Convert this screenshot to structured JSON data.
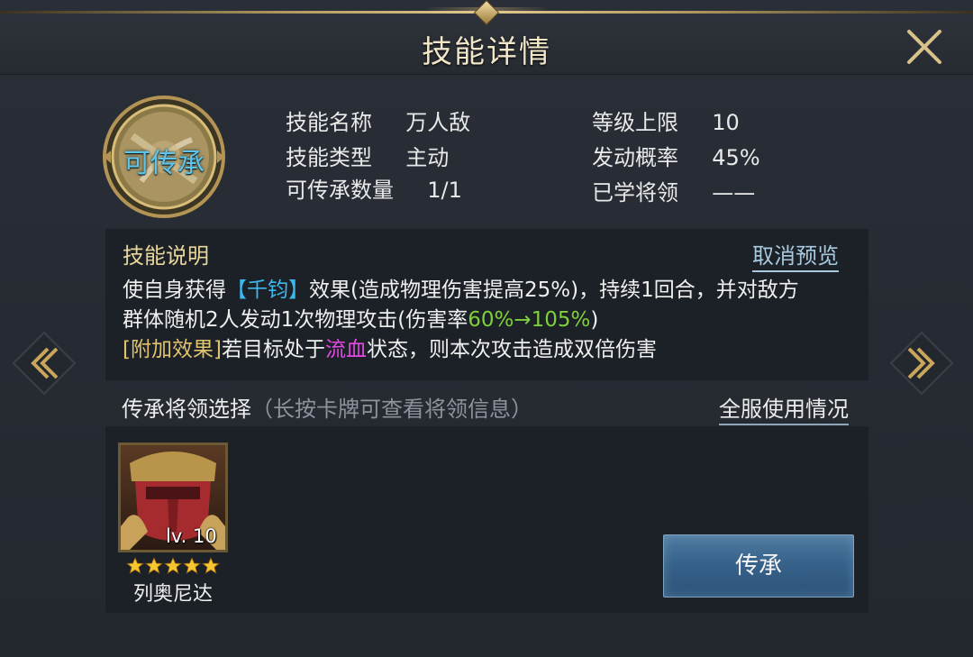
{
  "header": {
    "title": "技能详情"
  },
  "skill_icon": {
    "label": "可传承"
  },
  "info": {
    "name_label": "技能名称",
    "name_value": "万人敌",
    "type_label": "技能类型",
    "type_value": "主动",
    "count_label": "可传承数量",
    "count_value": "1/1",
    "max_level_label": "等级上限",
    "max_level_value": "10",
    "chance_label": "发动概率",
    "chance_value": "45%",
    "learned_label": "已学将领",
    "learned_value": "——"
  },
  "description": {
    "title": "技能说明",
    "cancel_preview": "取消预览",
    "line1_a": "使自身获得",
    "line1_effect": "【千钧】",
    "line1_b": "效果(造成物理伤害提高25%)，持续1回合，并对敌方",
    "line2_a": "群体随机2人发动1次物理攻击(伤害率",
    "line2_rate": "60%→105%",
    "line2_b": ")",
    "line3_tag": "[附加效果]",
    "line3_a": "若目标处于",
    "line3_status": "流血",
    "line3_b": "状态，则本次攻击造成双倍伤害"
  },
  "selection": {
    "title": "传承将领选择",
    "hint": "（长按卡牌可查看将领信息）",
    "server_usage": "全服使用情况"
  },
  "general": {
    "level": "lv. 10",
    "stars": 5,
    "name": "列奥尼达"
  },
  "inherit_button": "传承",
  "colors": {
    "accent_gold": "#e8d69a",
    "effect_blue": "#3cb8ef",
    "rate_green": "#7fcf3a",
    "status_magenta": "#e348e3",
    "button_blue": "#37628a"
  }
}
